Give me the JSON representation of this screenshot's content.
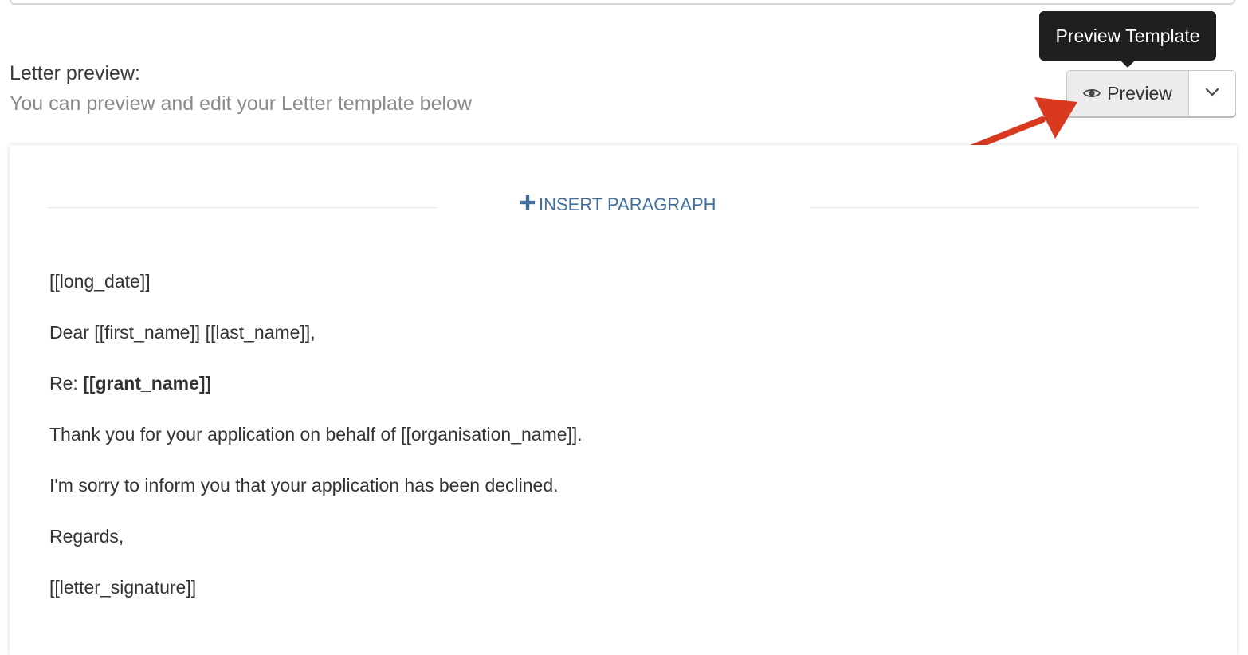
{
  "header": {
    "title": "Letter preview:",
    "subtitle": "You can preview and edit your Letter template below"
  },
  "tooltip": {
    "text": "Preview Template"
  },
  "toolbar": {
    "preview_label": "Preview"
  },
  "editor": {
    "insert_paragraph_label": "INSERT PARAGRAPH"
  },
  "letter": {
    "line_date": "[[long_date]]",
    "line_greeting": "Dear [[first_name]] [[last_name]],",
    "line_re_prefix": "Re: ",
    "line_re_value": "[[grant_name]]",
    "line_thanks": "Thank you for your application on behalf of [[organisation_name]].",
    "line_declined": "I'm sorry to inform you that your application has been declined.",
    "line_regards": "Regards,",
    "line_signature": "[[letter_signature]]"
  },
  "colors": {
    "accent_link": "#3f6f9e",
    "annotation_arrow": "#d93a1f",
    "tooltip_bg": "#1f1f1f"
  },
  "icons": {
    "preview": "eye-icon",
    "dropdown": "chevron-down-icon",
    "insert": "plus-icon"
  }
}
